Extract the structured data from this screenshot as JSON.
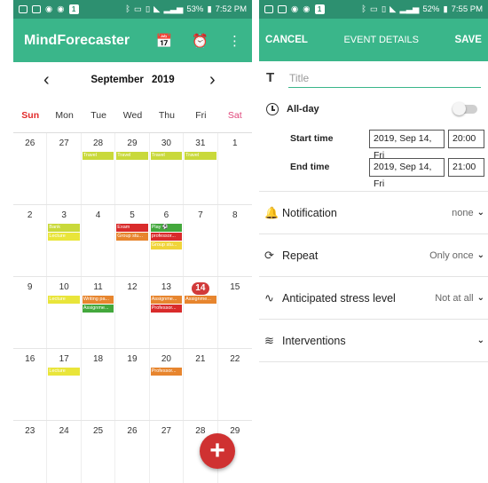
{
  "left": {
    "status": {
      "battery": "53%",
      "time": "7:52 PM"
    },
    "app_title": "MindForecaster",
    "month": "September",
    "year": "2019",
    "weekdays": [
      "Sun",
      "Mon",
      "Tue",
      "Wed",
      "Thu",
      "Fri",
      "Sat"
    ],
    "weeks": [
      [
        {
          "d": "26",
          "events": []
        },
        {
          "d": "27",
          "events": []
        },
        {
          "d": "28",
          "events": [
            {
              "t": "Travel",
              "c": "#c9d93a"
            }
          ]
        },
        {
          "d": "29",
          "events": [
            {
              "t": "Travel",
              "c": "#c9d93a"
            }
          ]
        },
        {
          "d": "30",
          "events": [
            {
              "t": "Travel",
              "c": "#c9d93a"
            }
          ]
        },
        {
          "d": "31",
          "events": [
            {
              "t": "Travel",
              "c": "#c9d93a"
            }
          ]
        },
        {
          "d": "1",
          "events": []
        }
      ],
      [
        {
          "d": "2",
          "events": []
        },
        {
          "d": "3",
          "events": [
            {
              "t": "Bank",
              "c": "#c9d93a"
            },
            {
              "t": "Lecture",
              "c": "#e9e53a"
            }
          ]
        },
        {
          "d": "4",
          "events": []
        },
        {
          "d": "5",
          "events": [
            {
              "t": "Exam",
              "c": "#d92b2b"
            },
            {
              "t": "Group stu...",
              "c": "#e7852e"
            }
          ]
        },
        {
          "d": "6",
          "events": [
            {
              "t": "Play ⚽",
              "c": "#43a83c"
            },
            {
              "t": "professor...",
              "c": "#d92b2b"
            },
            {
              "t": "Group stu...",
              "c": "#f0d43a"
            }
          ]
        },
        {
          "d": "7",
          "events": []
        },
        {
          "d": "8",
          "events": []
        }
      ],
      [
        {
          "d": "9",
          "events": []
        },
        {
          "d": "10",
          "events": [
            {
              "t": "Lecture",
              "c": "#e9e53a"
            }
          ]
        },
        {
          "d": "11",
          "events": [
            {
              "t": "Writing pa...",
              "c": "#e7852e"
            },
            {
              "t": "Assignme...",
              "c": "#43a83c"
            }
          ]
        },
        {
          "d": "12",
          "events": []
        },
        {
          "d": "13",
          "events": [
            {
              "t": "Assignme...",
              "c": "#e7852e"
            },
            {
              "t": "Professor...",
              "c": "#d92b2b"
            }
          ]
        },
        {
          "d": "14",
          "today": true,
          "events": [
            {
              "t": "Assignme...",
              "c": "#e7852e"
            }
          ]
        },
        {
          "d": "15",
          "events": []
        }
      ],
      [
        {
          "d": "16",
          "events": []
        },
        {
          "d": "17",
          "events": [
            {
              "t": "Lecture",
              "c": "#e9e53a"
            }
          ]
        },
        {
          "d": "18",
          "events": []
        },
        {
          "d": "19",
          "events": []
        },
        {
          "d": "20",
          "events": [
            {
              "t": "Professor...",
              "c": "#e7852e"
            }
          ]
        },
        {
          "d": "21",
          "events": []
        },
        {
          "d": "22",
          "events": []
        }
      ],
      [
        {
          "d": "23",
          "events": []
        },
        {
          "d": "24",
          "events": []
        },
        {
          "d": "25",
          "events": []
        },
        {
          "d": "26",
          "events": []
        },
        {
          "d": "27",
          "events": []
        },
        {
          "d": "28",
          "events": []
        },
        {
          "d": "29",
          "events": []
        }
      ]
    ],
    "fab_label": "+"
  },
  "right": {
    "status": {
      "battery": "52%",
      "time": "7:55 PM"
    },
    "cancel": "CANCEL",
    "title": "EVENT DETAILS",
    "save": "SAVE",
    "title_placeholder": "Title",
    "all_day": "All-day",
    "start_label": "Start time",
    "start_date": "2019, Sep 14, Fri",
    "start_time": "20:00",
    "end_label": "End time",
    "end_date": "2019, Sep 14, Fri",
    "end_time": "21:00",
    "options": [
      {
        "name": "notification",
        "icon": "bell-icon",
        "glyph": "🔔",
        "label": "Notification",
        "value": "none"
      },
      {
        "name": "repeat",
        "icon": "repeat-icon",
        "glyph": "⟳",
        "label": "Repeat",
        "value": "Only once"
      },
      {
        "name": "stress",
        "icon": "pulse-icon",
        "glyph": "∿",
        "label": "Anticipated stress level",
        "value": "Not at all"
      },
      {
        "name": "interventions",
        "icon": "layers-icon",
        "glyph": "≋",
        "label": "Interventions",
        "value": ""
      }
    ]
  },
  "colors": {
    "primary": "#3ab68a",
    "status": "#2d9070",
    "sunday": "#e22a2a",
    "saturday": "#e0457a",
    "fab": "#cf3131"
  }
}
